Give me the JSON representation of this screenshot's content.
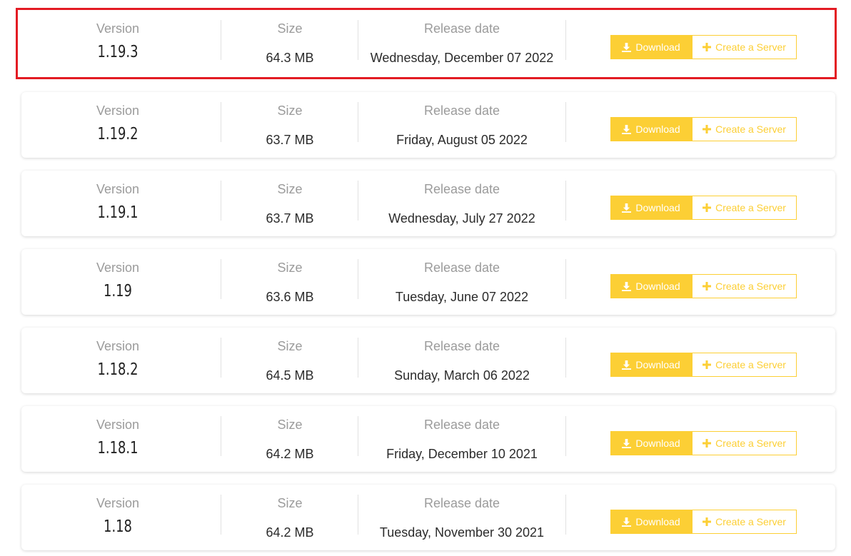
{
  "labels": {
    "version": "Version",
    "size": "Size",
    "release_date": "Release date"
  },
  "buttons": {
    "download": "Download",
    "create_server": "Create a Server"
  },
  "colors": {
    "accent": "#fccf35",
    "highlight_border": "#e31b23"
  },
  "icons": {
    "download": "download-icon",
    "create_server": "plus-icon"
  },
  "releases": [
    {
      "version": "1.19.3",
      "size": "64.3 MB",
      "date": "Wednesday, December 07 2022",
      "highlighted": true
    },
    {
      "version": "1.19.2",
      "size": "63.7 MB",
      "date": "Friday, August 05 2022"
    },
    {
      "version": "1.19.1",
      "size": "63.7 MB",
      "date": "Wednesday, July 27 2022"
    },
    {
      "version": "1.19",
      "size": "63.6 MB",
      "date": "Tuesday, June 07 2022"
    },
    {
      "version": "1.18.2",
      "size": "64.5 MB",
      "date": "Sunday, March 06 2022"
    },
    {
      "version": "1.18.1",
      "size": "64.2 MB",
      "date": "Friday, December 10 2021"
    },
    {
      "version": "1.18",
      "size": "64.2 MB",
      "date": "Tuesday, November 30 2021"
    }
  ]
}
